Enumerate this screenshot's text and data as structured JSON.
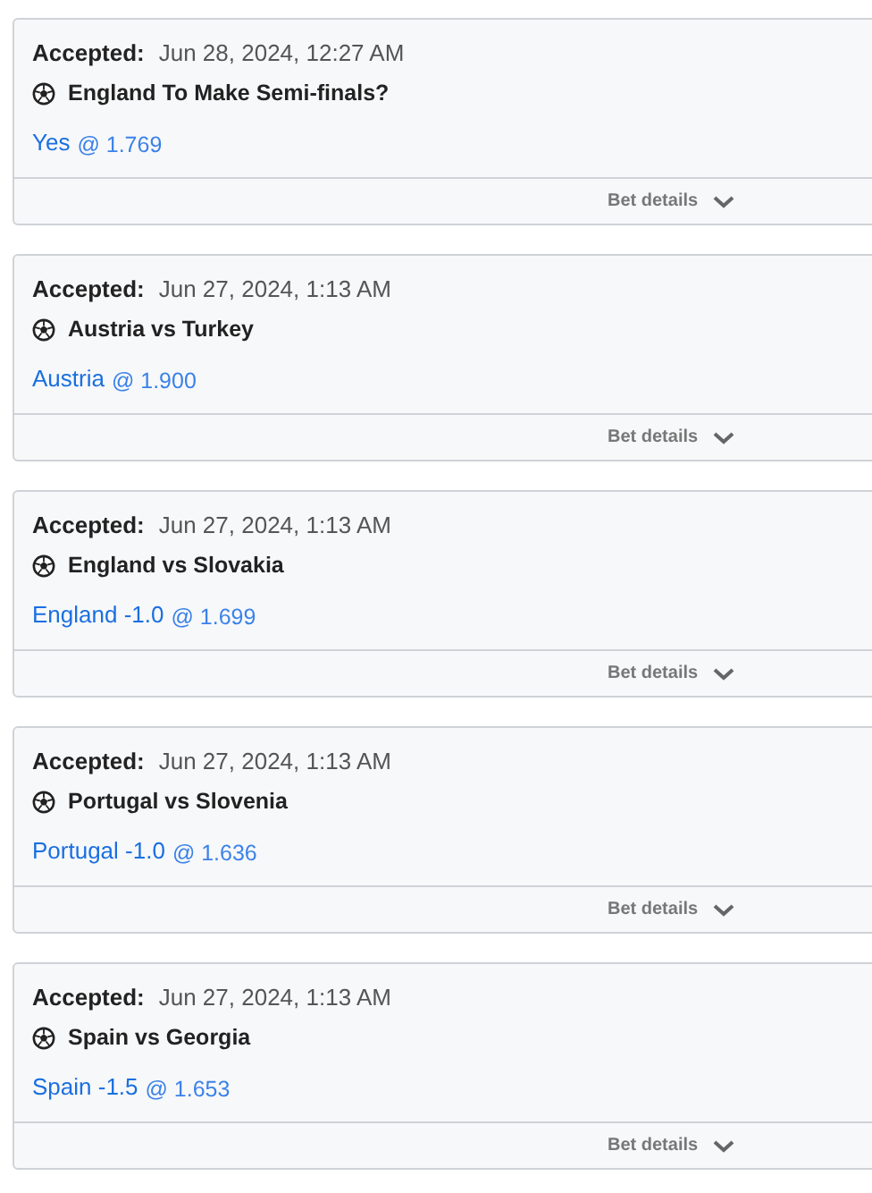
{
  "bets": [
    {
      "accepted_label": "Accepted:",
      "time": "Jun 28, 2024, 12:27 AM",
      "event": "England To Make Semi-finals?",
      "selection": "Yes",
      "odds": "@ 1.769",
      "details": "Bet details",
      "expanded": false
    },
    {
      "accepted_label": "Accepted:",
      "time": "Jun 27, 2024, 1:13 AM",
      "event": "Austria vs Turkey",
      "selection": "Austria",
      "odds": "@ 1.900",
      "details": "Bet details",
      "expanded": false
    },
    {
      "accepted_label": "Accepted:",
      "time": "Jun 27, 2024, 1:13 AM",
      "event": "England vs Slovakia",
      "selection": "England -1.0",
      "odds": "@ 1.699",
      "details": "Bet details",
      "expanded": false
    },
    {
      "accepted_label": "Accepted:",
      "time": "Jun 27, 2024, 1:13 AM",
      "event": "Portugal vs Slovenia",
      "selection": "Portugal -1.0",
      "odds": "@ 1.636",
      "details": "Bet details",
      "expanded": false
    },
    {
      "accepted_label": "Accepted:",
      "time": "Jun 27, 2024, 1:13 AM",
      "event": "Spain vs Georgia",
      "selection": "Spain -1.5",
      "odds": "@ 1.653",
      "details": "Bet details",
      "expanded": false
    }
  ]
}
